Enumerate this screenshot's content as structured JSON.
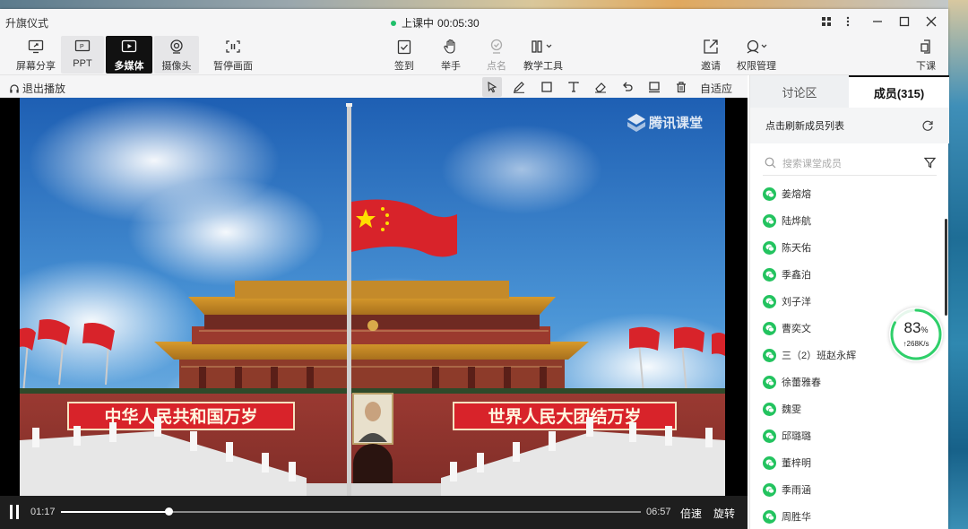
{
  "window": {
    "title": "升旗仪式",
    "status": "上课中",
    "elapsed": "00:05:30"
  },
  "toolbar": {
    "left": [
      {
        "label": "屏幕分享",
        "icon": "screen-share-icon"
      },
      {
        "label": "PPT",
        "icon": "ppt-icon"
      },
      {
        "label": "多媒体",
        "icon": "multimedia-icon"
      },
      {
        "label": "摄像头",
        "icon": "camera-icon"
      },
      {
        "label": "暂停画面",
        "icon": "pause-screen-icon"
      }
    ],
    "center": [
      {
        "label": "签到",
        "icon": "check-in-icon"
      },
      {
        "label": "举手",
        "icon": "raise-hand-icon"
      },
      {
        "label": "点名",
        "icon": "roll-call-icon"
      },
      {
        "label": "教学工具",
        "icon": "teaching-tools-icon"
      }
    ],
    "right": [
      {
        "label": "邀请",
        "icon": "invite-icon"
      },
      {
        "label": "权限管理",
        "icon": "permission-icon"
      },
      {
        "label": "下课",
        "icon": "end-class-icon"
      }
    ]
  },
  "player": {
    "exit_label": "退出播放",
    "fit_label": "自适应",
    "tools": [
      "pointer-icon",
      "pen-icon",
      "rectangle-icon",
      "text-icon",
      "eraser-icon",
      "undo-icon",
      "screen-icon",
      "trash-icon"
    ]
  },
  "video": {
    "watermark": "腾讯课堂",
    "banner_left": "中华人民共和国万岁",
    "banner_right": "世界人民大团结万岁"
  },
  "playback": {
    "current": "01:17",
    "duration": "06:57",
    "progress": 0.185,
    "speed_label": "倍速",
    "rotate_label": "旋转"
  },
  "panel": {
    "tab_discussion": "讨论区",
    "tab_members": "成员(315)",
    "refresh_text": "点击刷新成员列表",
    "search_placeholder": "搜索课堂成员",
    "members": [
      "姜熔熔",
      "陆烨航",
      "陈天佑",
      "季鑫泊",
      "刘子洋",
      "曹奕文",
      "三（2）班赵永辉",
      "徐蕾雅春",
      "魏雯",
      "邱璐璐",
      "董梓明",
      "季雨涵",
      "周胜华"
    ]
  },
  "network": {
    "percent": "83",
    "percent_unit": "%",
    "speed": "↑268K/s"
  },
  "colors": {
    "accent_green": "#23c35f",
    "active_tool": "#111111",
    "flag_red": "#d8232a"
  }
}
